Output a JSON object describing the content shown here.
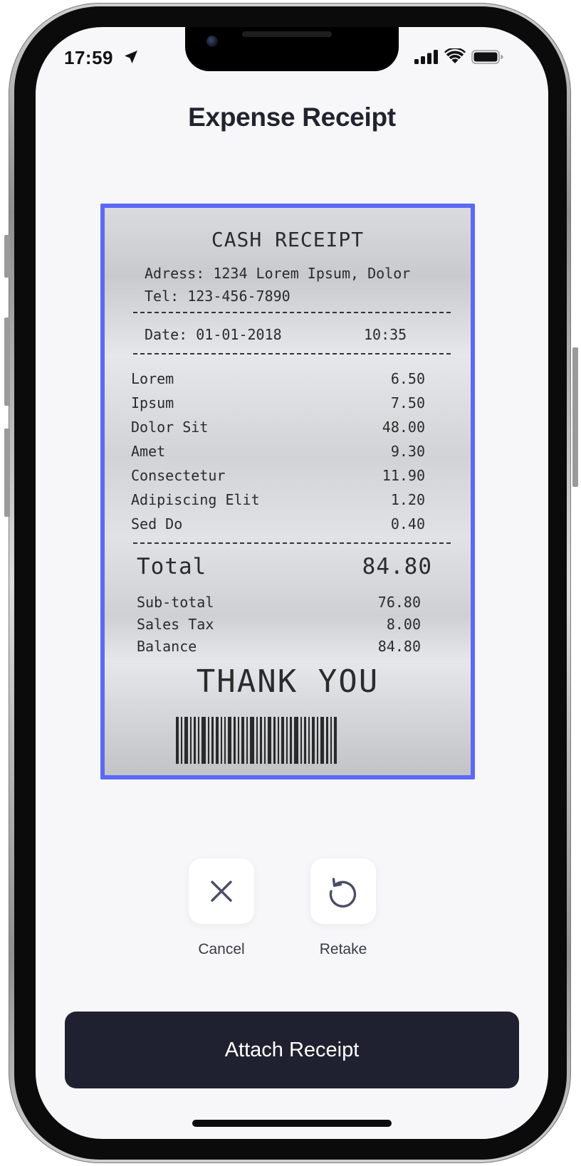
{
  "status_bar": {
    "time": "17:59",
    "icons": [
      "location-arrow-icon",
      "cellular-signal-icon",
      "wifi-icon",
      "battery-icon"
    ]
  },
  "header": {
    "title": "Expense Receipt"
  },
  "receipt": {
    "heading": "CASH RECEIPT",
    "address": "Adress: 1234 Lorem Ipsum, Dolor",
    "tel": "Tel: 123-456-7890",
    "date": "Date: 01-01-2018",
    "time": "10:35",
    "items": [
      {
        "name": "Lorem",
        "price": "6.50"
      },
      {
        "name": "Ipsum",
        "price": "7.50"
      },
      {
        "name": "Dolor Sit",
        "price": "48.00"
      },
      {
        "name": "Amet",
        "price": "9.30"
      },
      {
        "name": "Consectetur",
        "price": "11.90"
      },
      {
        "name": "Adipiscing Elit",
        "price": "1.20"
      },
      {
        "name": "Sed Do",
        "price": "0.40"
      }
    ],
    "total_label": "Total",
    "total_value": "84.80",
    "summary": [
      {
        "name": "Sub-total",
        "value": "76.80"
      },
      {
        "name": "Sales Tax",
        "value": "8.00"
      },
      {
        "name": "Balance",
        "value": "84.80"
      }
    ],
    "thanks": "THANK YOU",
    "frame_color": "#5b69f5"
  },
  "actions": {
    "cancel_label": "Cancel",
    "cancel_icon": "close-icon",
    "retake_label": "Retake",
    "retake_icon": "retake-icon"
  },
  "primary_button": {
    "label": "Attach Receipt",
    "color": "#1f2130"
  }
}
